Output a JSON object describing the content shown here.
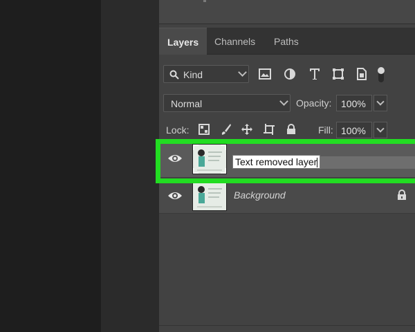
{
  "tabs": [
    {
      "label": "Layers"
    },
    {
      "label": "Channels"
    },
    {
      "label": "Paths"
    }
  ],
  "filter": {
    "label": "Kind"
  },
  "blend": {
    "mode": "Normal",
    "opacity_label": "Opacity:",
    "opacity_value": "100%"
  },
  "lock": {
    "label": "Lock:",
    "fill_label": "Fill:",
    "fill_value": "100%"
  },
  "layers": [
    {
      "name": "Text removed layer",
      "editing": true
    },
    {
      "name": "Background",
      "locked": true
    }
  ],
  "colors": {
    "highlight": "#22dd22",
    "panel": "#424242",
    "selected_row": "#5a5a5a"
  }
}
